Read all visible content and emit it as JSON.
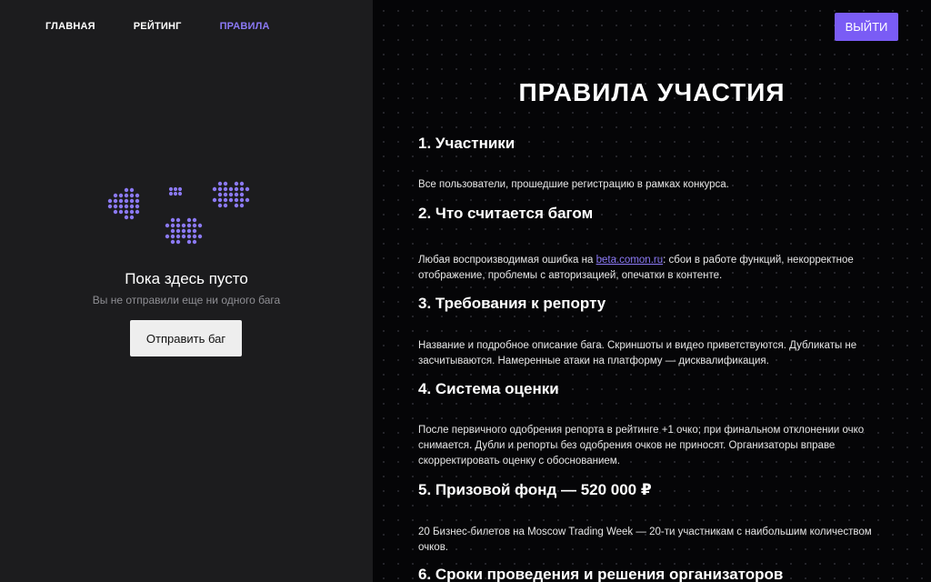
{
  "nav": {
    "items": [
      {
        "label": "ГЛАВНАЯ",
        "active": false
      },
      {
        "label": "РЕЙТИНГ",
        "active": false
      },
      {
        "label": "ПРАВИЛА",
        "active": true
      }
    ]
  },
  "empty_state": {
    "title": "Пока здесь пусто",
    "subtitle": "Вы не отправили еще ни одного бага",
    "button_label": "Отправить баг"
  },
  "header": {
    "logout_label": "ВЫЙТИ"
  },
  "rules": {
    "title": "ПРАВИЛА УЧАСТИЯ",
    "sections": [
      {
        "heading": "1. Участники",
        "text": "Все пользователи, прошедшие регистрацию в рамках конкурса."
      },
      {
        "heading": "2. Что считается багом",
        "text_before": "Любая воспроизводимая ошибка на ",
        "link": "beta.comon.ru",
        "text_after": ": сбои в работе функций, некорректное отображение, проблемы с авторизацией, опечатки в контенте."
      },
      {
        "heading": "3. Требования к репорту",
        "text": "Название и подробное описание бага. Скриншоты и видео приветствуются. Дубликаты не засчитываются. Намеренные атаки на платформу — дисквалификация."
      },
      {
        "heading": "4. Система оценки",
        "text": "После первичного одобрения репорта в рейтинге +1 очко; при финальном отклонении очко снимается. Дубли и репорты без одобрения очков не приносят. Организаторы вправе скорректировать оценку с обоснованием."
      },
      {
        "heading": "5. Призовой фонд — 520 000 ₽",
        "text": "20 Бизнес-билетов на Moscow Trading Week — 20-ти участникам с наибольшим количеством очков."
      },
      {
        "heading": "6. Сроки проведения и решения организаторов"
      }
    ]
  },
  "colors": {
    "accent": "#7a5cf5",
    "nav_active": "#8b79f5",
    "left_bg": "#1c1c1e",
    "right_bg": "#050507"
  }
}
